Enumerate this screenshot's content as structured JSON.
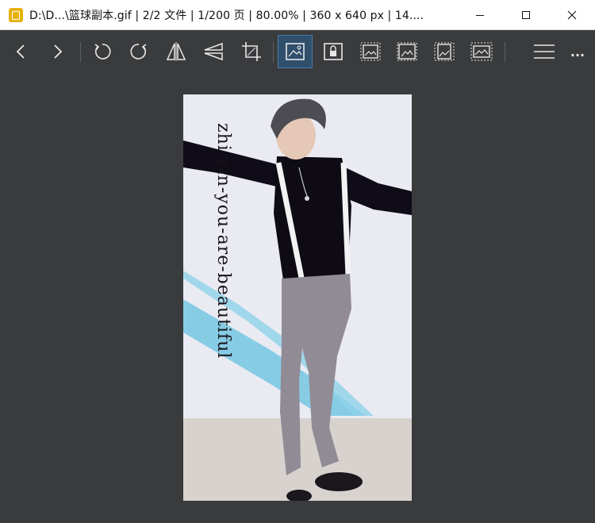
{
  "window": {
    "title": "D:\\D...\\篮球副本.gif  |  2/2 文件  |  1/200 页  |  80.00%  |  360 x 640 px  |  14....",
    "app_icon": "image-viewer-app-icon"
  },
  "toolbar": {
    "buttons": [
      "previous",
      "next",
      "rotate-left",
      "rotate-right",
      "flip-horizontal",
      "flip-vertical",
      "crop",
      "fit-window",
      "lock-zoom",
      "original-size",
      "fit-width",
      "fit-height",
      "fill-screen",
      "menu",
      "more"
    ],
    "active": "fit-window",
    "more_label": "..."
  },
  "image": {
    "watermark": "zhi-yin-you-are-beautiful",
    "colors": {
      "background": "#e9eaf1",
      "floor": "#d6d0cc",
      "shirt": "#0e0b15",
      "pants": "#8e8a92",
      "blue_band": "#7cc9e3"
    }
  }
}
